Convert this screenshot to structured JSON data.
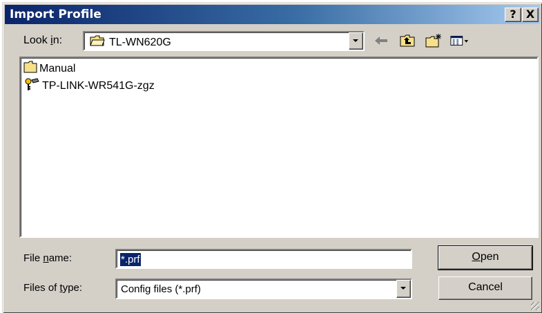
{
  "window": {
    "title": "Import Profile",
    "help_label": "?",
    "close_label": "X"
  },
  "lookin": {
    "label_pre": "Look ",
    "label_accel": "i",
    "label_post": "n:",
    "value": "TL-WN620G"
  },
  "toolbar": {
    "icons": [
      "back-arrow-icon",
      "up-folder-icon",
      "new-folder-icon",
      "view-menu-icon"
    ]
  },
  "files": [
    {
      "name": "Manual",
      "icon": "folder-icon"
    },
    {
      "name": "TP-LINK-WR541G-zgz",
      "icon": "profile-key-icon"
    }
  ],
  "filename": {
    "label_pre": "File ",
    "label_accel": "n",
    "label_post": "ame:",
    "value": "*.prf"
  },
  "filetype": {
    "label_pre": "Files of ",
    "label_accel": "t",
    "label_post": "ype:",
    "value": "Config files (*.prf)"
  },
  "buttons": {
    "open_accel": "O",
    "open_rest": "pen",
    "cancel": "Cancel"
  },
  "colors": {
    "titlebar_start": "#0a246a",
    "titlebar_end": "#a6caf0",
    "face": "#d4d0c8",
    "selection": "#0a246a"
  }
}
